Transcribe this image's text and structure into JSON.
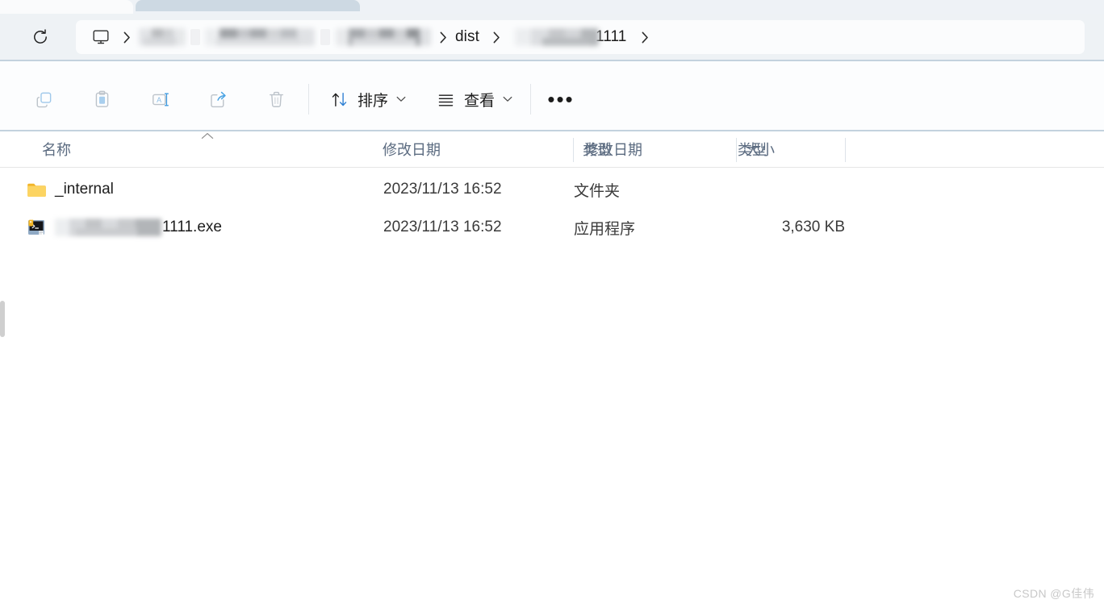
{
  "window": {
    "type": "windows-file-explorer",
    "accent_color": "#2d7fd3",
    "folder_icon_color": "#f6c343",
    "watermark": "CSDN @G佳伟"
  },
  "tabs": {
    "active_tab_label": "",
    "inactive_tab_label": ""
  },
  "address_bar": {
    "refresh_icon": "refresh-icon",
    "root_icon": "this-pc-monitor-icon",
    "crumbs": [
      {
        "label": "",
        "redacted": true
      },
      {
        "label": "",
        "redacted": true
      },
      {
        "label": "",
        "redacted": true
      },
      {
        "label": "dist",
        "redacted": false
      },
      {
        "label": "1111",
        "redacted": true
      }
    ],
    "separator_glyph": "chevron-right-icon"
  },
  "toolbar": {
    "icon_buttons": [
      {
        "name": "copy-button",
        "icon": "copy-icon",
        "enabled": false
      },
      {
        "name": "paste-button",
        "icon": "paste-icon",
        "enabled": false
      },
      {
        "name": "rename-button",
        "icon": "rename-icon",
        "enabled": false
      },
      {
        "name": "share-button",
        "icon": "share-icon",
        "enabled": false
      },
      {
        "name": "delete-button",
        "icon": "trash-icon",
        "enabled": false
      }
    ],
    "sort_label": "排序",
    "view_label": "查看",
    "more_label": "•••"
  },
  "columns": {
    "name": "名称",
    "date_modified": "修改日期",
    "type": "类型",
    "size": "大小",
    "sorted_by": "名称",
    "sort_direction": "ascending"
  },
  "files": [
    {
      "name": "_internal",
      "name_redacted": false,
      "icon": "folder-icon",
      "date_modified": "2023/11/13 16:52",
      "type": "文件夹",
      "size": ""
    },
    {
      "name": "1111.exe",
      "name_redacted": true,
      "icon": "exe-application-icon",
      "date_modified": "2023/11/13 16:52",
      "type": "应用程序",
      "size": "3,630 KB"
    }
  ]
}
